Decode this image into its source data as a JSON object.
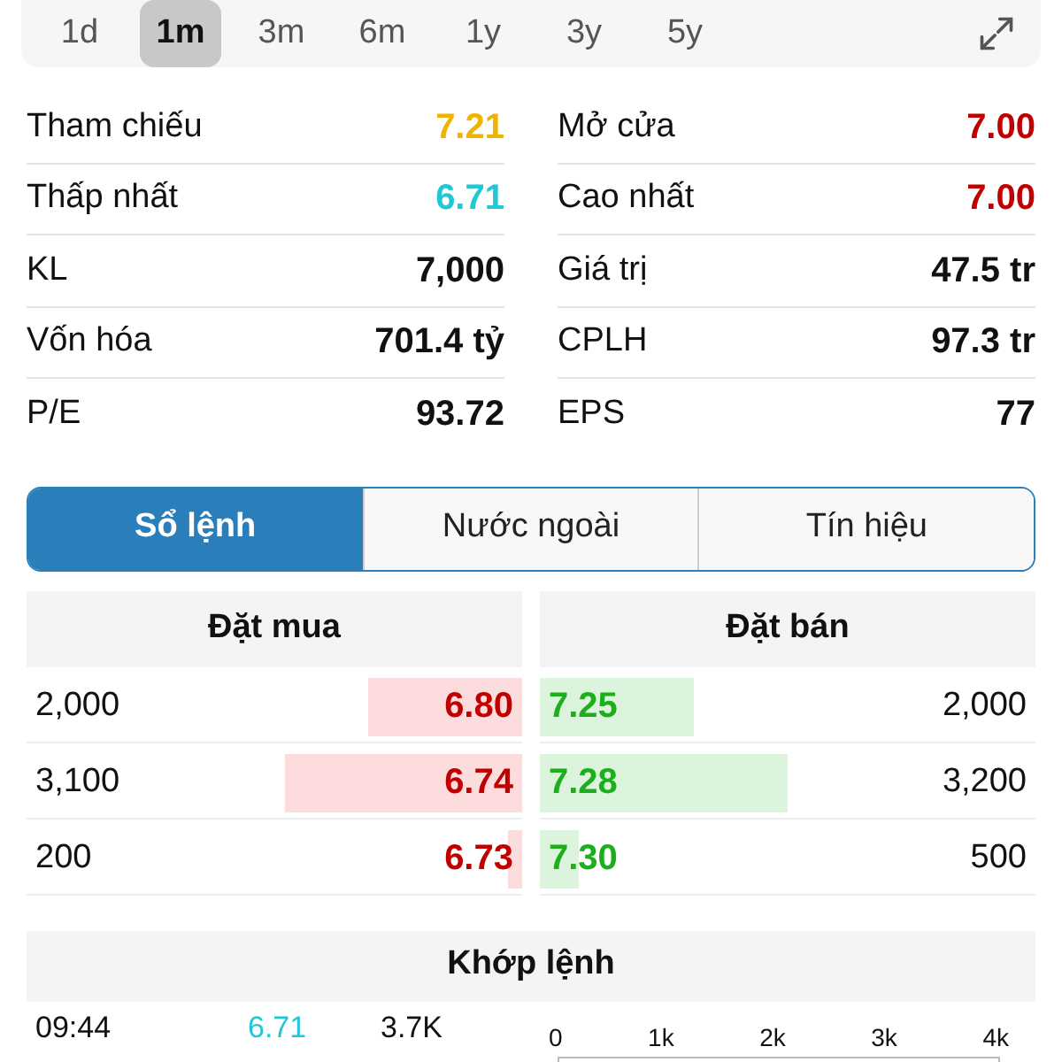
{
  "periods": [
    {
      "label": "1d",
      "selected": false
    },
    {
      "label": "1m",
      "selected": true
    },
    {
      "label": "3m",
      "selected": false
    },
    {
      "label": "6m",
      "selected": false
    },
    {
      "label": "1y",
      "selected": false
    },
    {
      "label": "3y",
      "selected": false
    },
    {
      "label": "5y",
      "selected": false
    }
  ],
  "stats": [
    {
      "label": "Tham chiếu",
      "value": "7.21",
      "color": "#f0b400"
    },
    {
      "label": "Mở cửa",
      "value": "7.00",
      "color": "#c00000"
    },
    {
      "label": "Thấp nhất",
      "value": "6.71",
      "color": "#1fc8d4"
    },
    {
      "label": "Cao nhất",
      "value": "7.00",
      "color": "#c00000"
    },
    {
      "label": "KL",
      "value": "7,000",
      "color": "#111111"
    },
    {
      "label": "Giá trị",
      "value": "47.5 tr",
      "color": "#111111"
    },
    {
      "label": "Vốn hóa",
      "value": "701.4 tỷ",
      "color": "#111111"
    },
    {
      "label": "CPLH",
      "value": "97.3 tr",
      "color": "#111111"
    },
    {
      "label": "P/E",
      "value": "93.72",
      "color": "#111111"
    },
    {
      "label": "EPS",
      "value": "77",
      "color": "#111111"
    }
  ],
  "tabs": [
    {
      "label": "Sổ lệnh",
      "selected": true
    },
    {
      "label": "Nước ngoài",
      "selected": false
    },
    {
      "label": "Tín hiệu",
      "selected": false
    }
  ],
  "order_book": {
    "bid_header": "Đặt mua",
    "ask_header": "Đặt bán",
    "rows": [
      {
        "bid": {
          "volume": "2,000",
          "price": "6.80",
          "level": 0.31
        },
        "ask": {
          "price": "7.25",
          "level": 0.31,
          "volume": "2,000"
        }
      },
      {
        "bid": {
          "volume": "3,100",
          "price": "6.74",
          "level": 0.48
        },
        "ask": {
          "price": "7.28",
          "level": 0.5,
          "volume": "3,200"
        }
      },
      {
        "bid": {
          "volume": "200",
          "price": "6.73",
          "level": 0.03
        },
        "ask": {
          "price": "7.30",
          "level": 0.08,
          "volume": "500"
        }
      }
    ]
  },
  "matched": {
    "title": "Khớp lệnh",
    "trades": [
      {
        "time": "09:44",
        "price": "6.71",
        "volume": "3.7K",
        "color": "#1fc8d4"
      }
    ],
    "axis_ticks": [
      "0",
      "1k",
      "2k",
      "3k",
      "4k"
    ]
  }
}
